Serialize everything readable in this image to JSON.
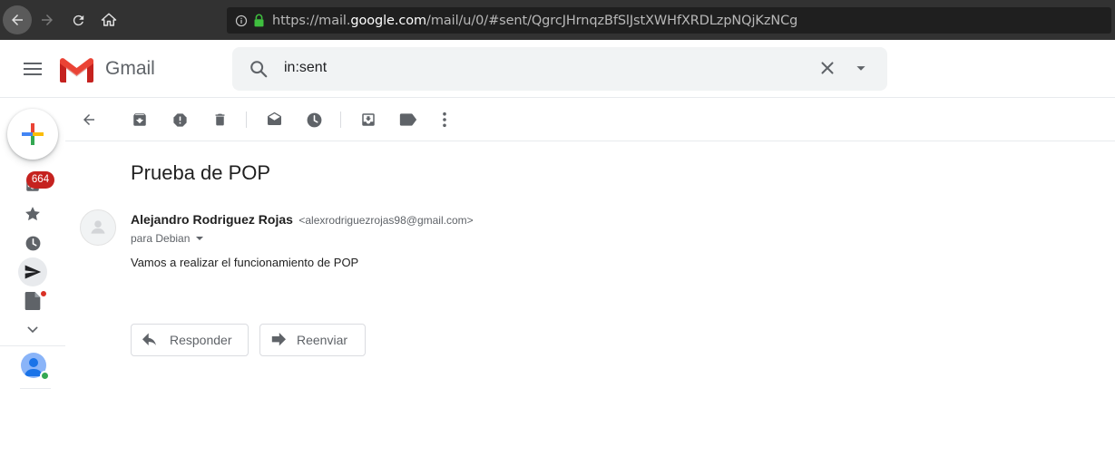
{
  "browser": {
    "url_prefix": "https://mail.",
    "url_host": "google.com",
    "url_path": "/mail/u/0/#sent/QgrcJHrnqzBfSlJstXWHfXRDLzpNQjKzNCg"
  },
  "header": {
    "app_title": "Gmail",
    "search_value": "in:sent"
  },
  "rail": {
    "inbox_badge": "664",
    "items": [
      "inbox-icon",
      "star-icon",
      "clock-icon",
      "send-icon",
      "draft-icon",
      "chevron-down-icon"
    ]
  },
  "toolbar": {
    "icons": [
      "back-arrow-icon",
      "archive-icon",
      "report-spam-icon",
      "delete-icon",
      "mark-unread-icon",
      "snooze-icon",
      "move-to-icon",
      "label-icon",
      "more-vert-icon"
    ]
  },
  "message": {
    "subject": "Prueba de POP",
    "sender_name": "Alejandro Rodriguez Rojas",
    "sender_email": "<alexrodriguezrojas98@gmail.com>",
    "recipient": "para Debian",
    "body": "Vamos a realizar el funcionamiento de POP",
    "reply_label": "Responder",
    "forward_label": "Reenviar"
  },
  "colors": {
    "badge": "#c5221f",
    "online": "#34a853",
    "search_bg": "#f1f3f4"
  }
}
